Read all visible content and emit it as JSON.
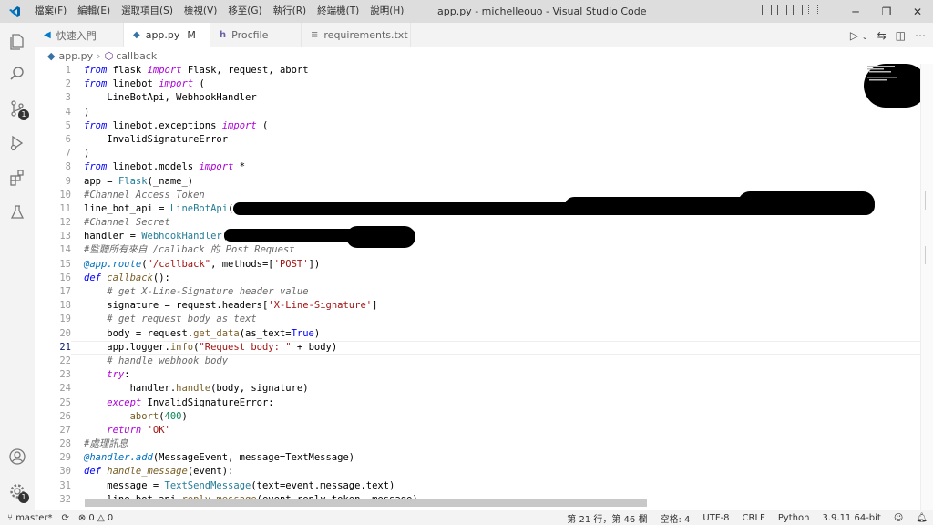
{
  "titlebar": {
    "menu": [
      "檔案(F)",
      "編輯(E)",
      "選取項目(S)",
      "檢視(V)",
      "移至(G)",
      "執行(R)",
      "終端機(T)",
      "說明(H)"
    ],
    "title": "app.py - michelleouo - Visual Studio Code"
  },
  "tabs": [
    {
      "label": "快速入門",
      "icon": "vscode-icon",
      "active": false
    },
    {
      "label": "app.py",
      "modified": "M",
      "icon": "python-icon",
      "active": true
    },
    {
      "label": "Procfile",
      "icon": "heroku-icon",
      "active": false
    },
    {
      "label": "requirements.txt",
      "icon": "text-file-icon",
      "active": false
    }
  ],
  "breadcrumb": {
    "file": "app.py",
    "symbol": "callback"
  },
  "editor": {
    "current_line": 21,
    "line_numbers": [
      "1",
      "2",
      "3",
      "4",
      "5",
      "6",
      "7",
      "8",
      "9",
      "10",
      "11",
      "12",
      "13",
      "14",
      "15",
      "16",
      "17",
      "18",
      "19",
      "20",
      "21",
      "22",
      "23",
      "24",
      "25",
      "26",
      "27",
      "28",
      "29",
      "30",
      "31",
      "32"
    ],
    "lines": [
      "from flask import Flask, request, abort",
      "from linebot import (",
      "    LineBotApi, WebhookHandler",
      ")",
      "from linebot.exceptions import (",
      "    InvalidSignatureError",
      ")",
      "from linebot.models import *",
      "app = Flask(_name_)",
      "#Channel Access Token",
      "line_bot_api = LineBotApi(",
      "#Channel Secret",
      "handler = WebhookHandler(",
      "#監聽所有來自 /callback 的 Post Request",
      "@app.route(\"/callback\", methods=['POST'])",
      "def callback():",
      "    # get X-Line-Signature header value",
      "    signature = request.headers['X-Line-Signature']",
      "    # get request body as text",
      "    body = request.get_data(as_text=True)",
      "    app.logger.info(\"Request body: \" + body)",
      "    # handle webhook body",
      "    try:",
      "        handler.handle(body, signature)",
      "    except InvalidSignatureError:",
      "        abort(400)",
      "    return 'OK'",
      "#處理訊息",
      "@handler.add(MessageEvent, message=TextMessage)",
      "def handle_message(event):",
      "    message = TextSendMessage(text=event.message.text)",
      "    line_bot_api.reply_message(event.reply_token, message)"
    ]
  },
  "statusbar": {
    "branch": "master*",
    "errors": "0",
    "warnings": "0",
    "position": "第 21 行，第 46 欄",
    "indent": "空格: 4",
    "encoding": "UTF-8",
    "eol": "CRLF",
    "language": "Python",
    "interpreter": "3.9.11 64-bit"
  }
}
